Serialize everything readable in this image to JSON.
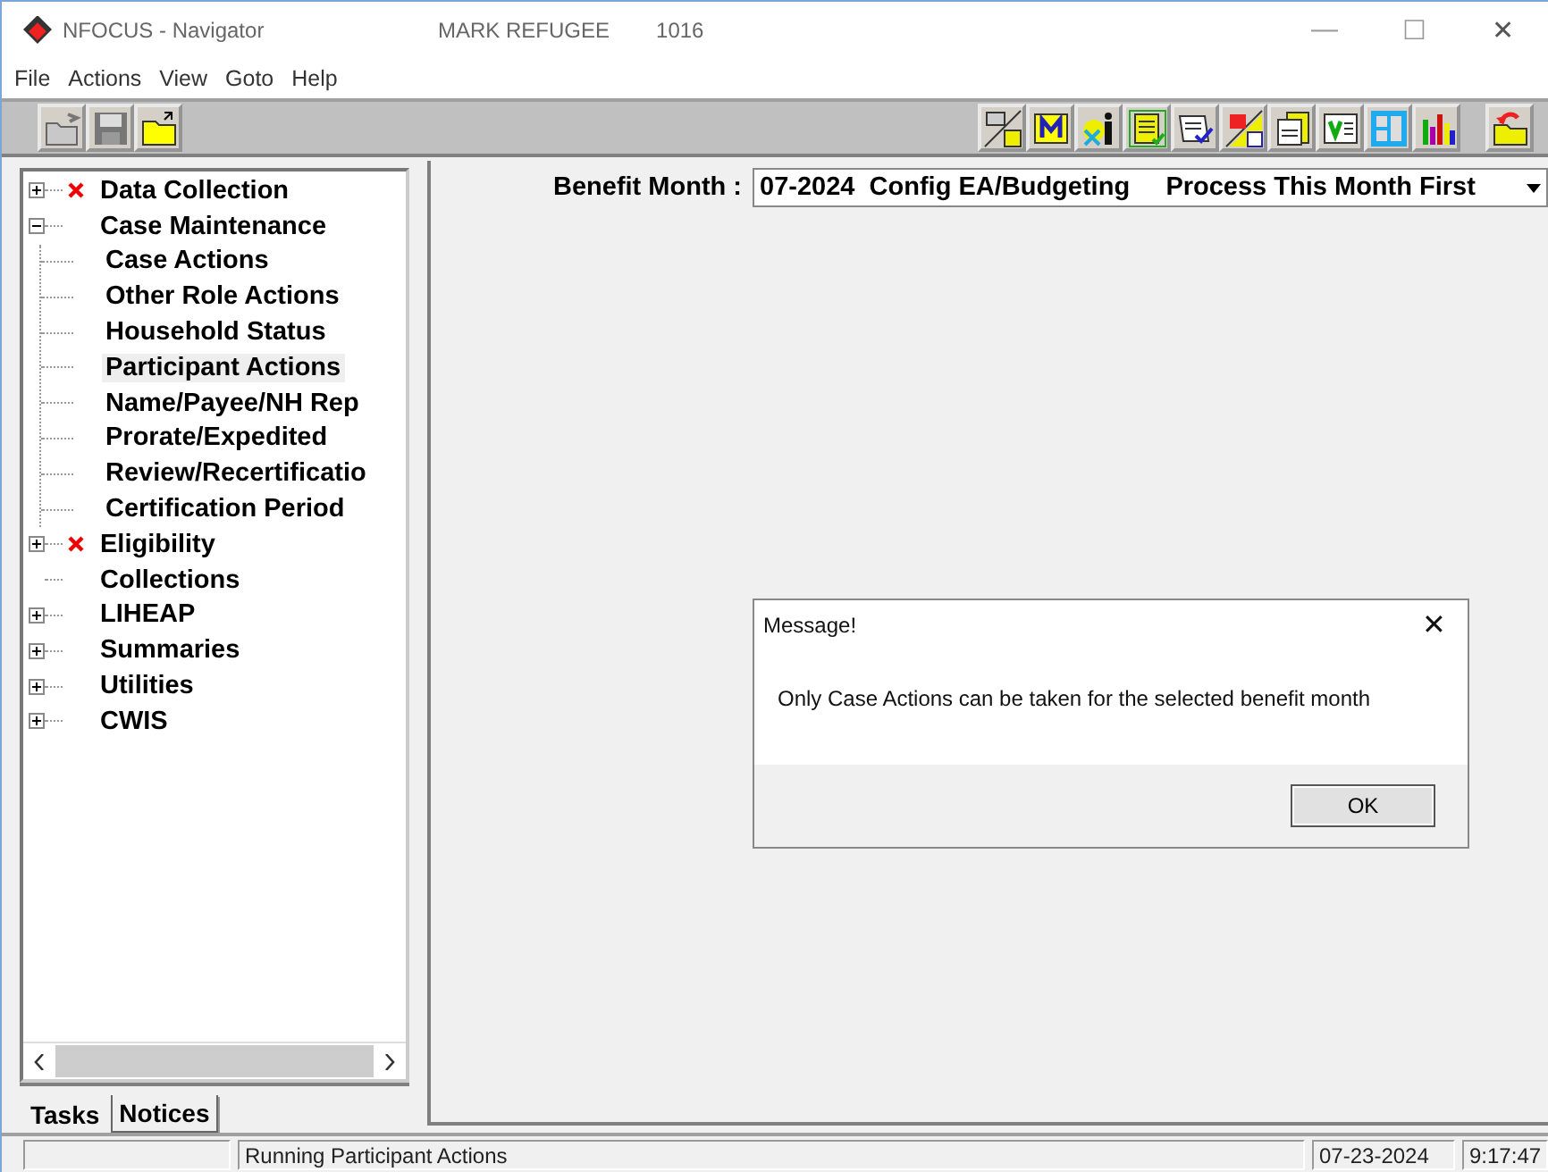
{
  "window": {
    "icon": "◆",
    "title": "NFOCUS - Navigator",
    "user": "MARK REFUGEE",
    "case_number": "1016",
    "controls": [
      "—",
      "☐",
      "✕"
    ]
  },
  "menu": [
    "File",
    "Actions",
    "View",
    "Goto",
    "Help"
  ],
  "tree": [
    {
      "label": "Data Collection",
      "error": true,
      "expanded": false,
      "selected": false
    },
    {
      "label": "Case Maintenance",
      "error": false,
      "expanded": true,
      "selected": false,
      "children": [
        {
          "label": "Case Actions",
          "selected": false
        },
        {
          "label": "Other Role Actions",
          "selected": false
        },
        {
          "label": "Household Status",
          "selected": false
        },
        {
          "label": "Participant Actions",
          "selected": true
        },
        {
          "label": "Name/Payee/NH Rep",
          "selected": false
        },
        {
          "label": "Prorate/Expedited",
          "selected": false
        },
        {
          "label": "Review/Recertificatio",
          "selected": false
        },
        {
          "label": "Certification Period",
          "selected": false
        }
      ]
    },
    {
      "label": "Eligibility",
      "error": true,
      "expanded": false,
      "selected": false
    },
    {
      "label": "Collections",
      "error": false,
      "selected": false
    },
    {
      "label": "LIHEAP",
      "error": false,
      "expanded": false,
      "selected": false
    },
    {
      "label": "Summaries",
      "error": false,
      "expanded": false,
      "selected": false
    },
    {
      "label": "Utilities",
      "error": false,
      "expanded": false,
      "selected": false
    },
    {
      "label": "CWIS",
      "error": false,
      "expanded": false,
      "selected": false
    }
  ],
  "tabs": [
    {
      "label": "Tasks",
      "selected": false
    },
    {
      "label": "Notices",
      "selected": true
    }
  ],
  "benefit_month": {
    "label": "Benefit Month :",
    "value": "07-2024  Config EA/Budgeting     Process This Month First"
  },
  "dialog": {
    "title": "Message!",
    "close": "✕",
    "message": "Only Case Actions can be taken for the selected benefit month",
    "button": "OK"
  },
  "status_bar": {
    "message": "Running Participant Actions",
    "date": "07-23-2024",
    "time": "9:17:47"
  }
}
